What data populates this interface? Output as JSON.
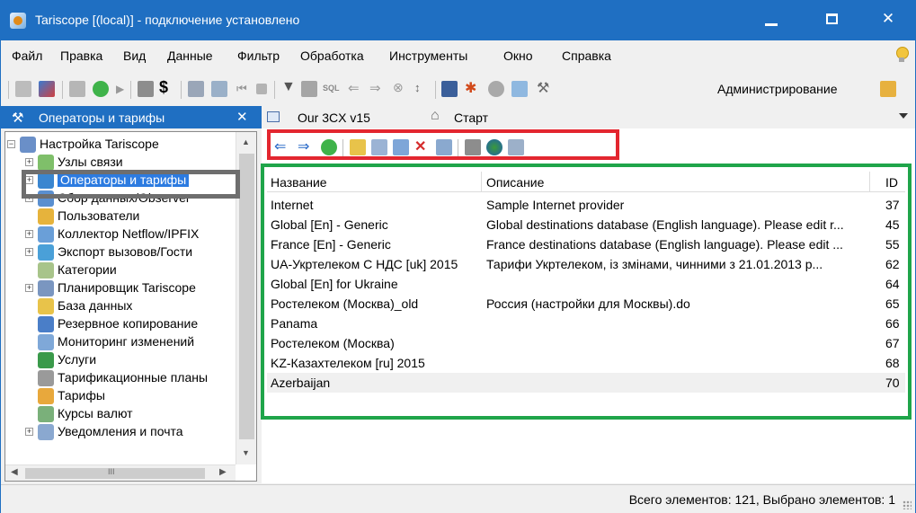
{
  "window": {
    "title": "Tariscope [(local)] - подключение установлено",
    "titlebar_color": "#1f6fc2"
  },
  "menu": {
    "items": [
      "Файл",
      "Правка",
      "Вид",
      "Данные",
      "Фильтр",
      "Обработка",
      "Инструменты",
      "Окно",
      "Справка"
    ]
  },
  "toolbar": {
    "admin_label": "Администрирование"
  },
  "tabs": {
    "left": {
      "label": "Операторы и тарифы",
      "close": "✕"
    },
    "right": [
      {
        "label": "Our 3CX v15",
        "icon": "grid-icon"
      },
      {
        "label": "Старт",
        "icon": "home-icon"
      }
    ]
  },
  "tree": {
    "items": [
      {
        "label": "Настройка Tariscope",
        "icon": "settings-icon",
        "indent": 0,
        "expander": "−"
      },
      {
        "label": "Узлы связи",
        "icon": "nodes-icon",
        "indent": 1,
        "expander": "+"
      },
      {
        "label": "Операторы и тарифы",
        "icon": "globe-icon",
        "indent": 1,
        "expander": "+",
        "selected": true
      },
      {
        "label": "Сбор данных/Observer",
        "icon": "collect-icon",
        "indent": 1,
        "expander": "+"
      },
      {
        "label": "Пользователи",
        "icon": "key-icon",
        "indent": 1,
        "expander": ""
      },
      {
        "label": "Коллектор Netflow/IPFIX",
        "icon": "network-icon",
        "indent": 1,
        "expander": "+"
      },
      {
        "label": "Экспорт вызовов/Гости",
        "icon": "export-icon",
        "indent": 1,
        "expander": "+"
      },
      {
        "label": "Категории",
        "icon": "categories-icon",
        "indent": 1,
        "expander": ""
      },
      {
        "label": "Планировщик Tariscope",
        "icon": "scheduler-icon",
        "indent": 1,
        "expander": "+"
      },
      {
        "label": "База данных",
        "icon": "database-icon",
        "indent": 1,
        "expander": ""
      },
      {
        "label": "Резервное копирование",
        "icon": "backup-icon",
        "indent": 1,
        "expander": ""
      },
      {
        "label": "Мониторинг изменений",
        "icon": "monitor-icon",
        "indent": 1,
        "expander": ""
      },
      {
        "label": "Услуги",
        "icon": "services-icon",
        "indent": 1,
        "expander": ""
      },
      {
        "label": "Тарификационные планы",
        "icon": "plans-icon",
        "indent": 1,
        "expander": ""
      },
      {
        "label": "Тарифы",
        "icon": "tariffs-icon",
        "indent": 1,
        "expander": ""
      },
      {
        "label": "Курсы валют",
        "icon": "currency-icon",
        "indent": 1,
        "expander": ""
      },
      {
        "label": "Уведомления и почта",
        "icon": "mail-icon",
        "indent": 1,
        "expander": "+"
      }
    ],
    "hscroll_label": "III"
  },
  "grid": {
    "columns": [
      "Название",
      "Описание",
      "ID"
    ],
    "rows": [
      {
        "name": "Internet",
        "desc": "Sample Internet provider",
        "id": "37"
      },
      {
        "name": "Global [En] - Generic",
        "desc": "Global destinations database (English language). Please edit r...",
        "id": "45"
      },
      {
        "name": "France [En] - Generic",
        "desc": "France destinations database (English language). Please edit ...",
        "id": "55"
      },
      {
        "name": "UA-Укртелеком С НДС [uk] 2015",
        "desc": "Тарифи Укртелеком, із змінами, чинними з 21.01.2013 р...",
        "id": "62"
      },
      {
        "name": "Global [En] for Ukraine",
        "desc": "",
        "id": "64"
      },
      {
        "name": "Ростелеком (Москва)_old",
        "desc": "Россия (настройки для Москвы).do",
        "id": "65"
      },
      {
        "name": "Panama",
        "desc": "",
        "id": "66"
      },
      {
        "name": "Ростелеком (Москва)",
        "desc": "",
        "id": "67"
      },
      {
        "name": "KZ-Казахтелеком [ru] 2015",
        "desc": "",
        "id": "68"
      },
      {
        "name": "Azerbaijan",
        "desc": "",
        "id": "70"
      }
    ]
  },
  "status": {
    "text": "Всего элементов: 121, Выбрано элементов: 1"
  },
  "highlight_colors": {
    "red": "#e3262f",
    "green": "#1fa54a",
    "gray": "#6e6e6e"
  }
}
